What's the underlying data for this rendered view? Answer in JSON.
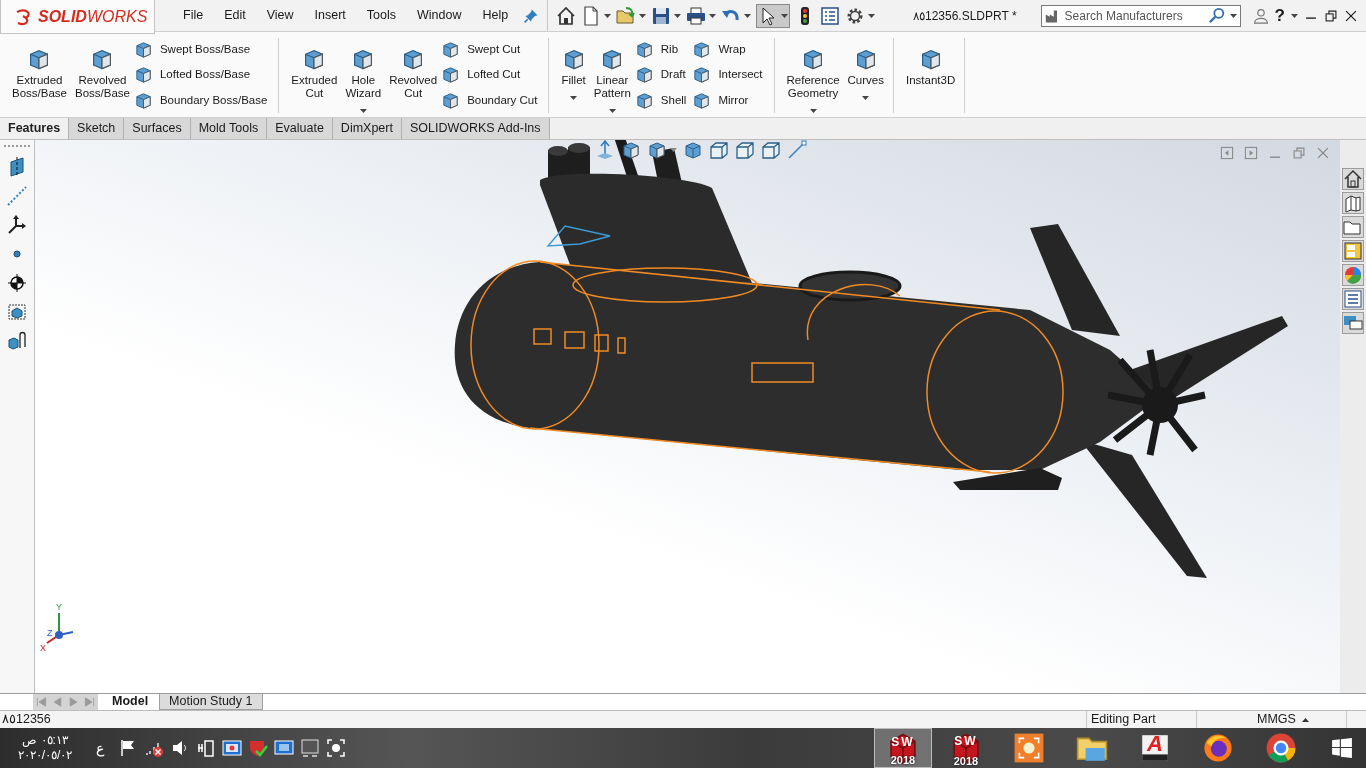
{
  "logo": "**SOLID**WORKS",
  "menu": [
    "File",
    "Edit",
    "View",
    "Insert",
    "Tools",
    "Window",
    "Help"
  ],
  "select_tool": {
    "selected": true
  },
  "document_title": "٨٥12356.SLDPRT *",
  "search": {
    "placeholder": "Search Manufacturers"
  },
  "help_label": "?",
  "ribbon": [
    {
      "items": [
        {
          "kind": "large",
          "label": "Extruded Boss/Base",
          "dropdown": false
        },
        {
          "kind": "large",
          "label": "Revolved Boss/Base",
          "dropdown": false
        },
        {
          "kind": "stack",
          "items": [
            {
              "label": "Swept Boss/Base"
            },
            {
              "label": "Lofted Boss/Base"
            },
            {
              "label": "Boundary Boss/Base"
            }
          ]
        }
      ]
    },
    {
      "items": [
        {
          "kind": "large",
          "label": "Extruded Cut",
          "dropdown": false
        },
        {
          "kind": "large",
          "label": "Hole Wizard",
          "dropdown": true
        },
        {
          "kind": "large",
          "label": "Revolved Cut",
          "dropdown": false
        },
        {
          "kind": "stack",
          "items": [
            {
              "label": "Swept Cut"
            },
            {
              "label": "Lofted Cut"
            },
            {
              "label": "Boundary Cut"
            }
          ]
        }
      ]
    },
    {
      "items": [
        {
          "kind": "large",
          "label": "Fillet",
          "dropdown": true
        },
        {
          "kind": "large",
          "label": "Linear Pattern",
          "dropdown": true
        },
        {
          "kind": "stack",
          "items": [
            {
              "label": "Rib"
            },
            {
              "label": "Draft"
            },
            {
              "label": "Shell"
            }
          ]
        },
        {
          "kind": "stack",
          "items": [
            {
              "label": "Wrap"
            },
            {
              "label": "Intersect"
            },
            {
              "label": "Mirror"
            }
          ]
        }
      ]
    },
    {
      "items": [
        {
          "kind": "large",
          "label": "Reference Geometry",
          "dropdown": true
        },
        {
          "kind": "large",
          "label": "Curves",
          "dropdown": true
        }
      ]
    },
    {
      "items": [
        {
          "kind": "large",
          "label": "Instant3D",
          "dropdown": false
        }
      ]
    }
  ],
  "command_tabs": [
    {
      "label": "Features",
      "selected": true
    },
    {
      "label": "Sketch",
      "selected": false
    },
    {
      "label": "Surfaces",
      "selected": false
    },
    {
      "label": "Mold Tools",
      "selected": false
    },
    {
      "label": "Evaluate",
      "selected": false
    },
    {
      "label": "DimXpert",
      "selected": false
    },
    {
      "label": "SOLIDWORKS Add-Ins",
      "selected": false
    }
  ],
  "triad": {
    "x": "X",
    "y": "Y",
    "z": "Z"
  },
  "bottom_tabs": [
    {
      "label": "Model",
      "selected": true
    },
    {
      "label": "Motion Study 1",
      "selected": false
    }
  ],
  "status_bar": {
    "document": "٨٥12356",
    "mode": "Editing Part",
    "units": "MMGS"
  },
  "taskbar": {
    "time": "٠٥:١٣ ص",
    "date": "٢٠٢٠/٠٥/٠٢",
    "language": "ع",
    "apps": [
      {
        "kind": "sw",
        "logo": "SW",
        "badge": "2018",
        "selected": true
      },
      {
        "kind": "sw",
        "logo": "SW",
        "badge": "2018",
        "selected": false
      },
      {
        "kind": "capture",
        "selected": false
      },
      {
        "kind": "explorer",
        "selected": false
      },
      {
        "kind": "autocad",
        "logo": "A",
        "selected": false
      },
      {
        "kind": "firefox",
        "selected": false
      },
      {
        "kind": "chrome",
        "selected": false
      }
    ]
  }
}
